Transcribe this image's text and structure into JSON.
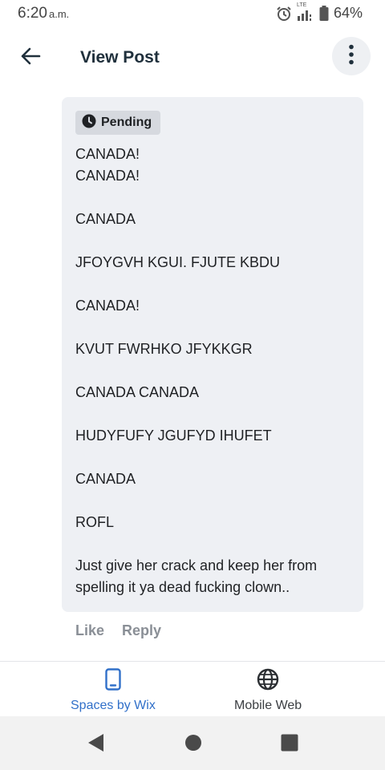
{
  "status_bar": {
    "time": "6:20",
    "ampm": "a.m.",
    "network": "LTE",
    "battery": "64%"
  },
  "header": {
    "title": "View Post"
  },
  "post": {
    "status_badge": "Pending",
    "lines": [
      "CANADA!",
      "CANADA!",
      "",
      "CANADA",
      "",
      "JFOYGVH KGUI. FJUTE KBDU",
      "",
      "CANADA!",
      "",
      "KVUT FWRHKO JFYKKGR",
      "",
      "CANADA CANADA",
      "",
      "HUDYFUFY JGUFYD IHUFET",
      "",
      "CANADA",
      "",
      "ROFL",
      ""
    ],
    "last_paragraph": "Just give her crack and keep her from spelling it ya dead fucking clown.."
  },
  "actions": {
    "like": "Like",
    "reply": "Reply"
  },
  "bottom_nav": {
    "spaces": "Spaces by Wix",
    "web": "Mobile Web"
  },
  "colors": {
    "accent": "#3170c9",
    "card_bg": "#eef0f4",
    "badge_bg": "#d6d9df",
    "muted": "#8a8f96"
  }
}
